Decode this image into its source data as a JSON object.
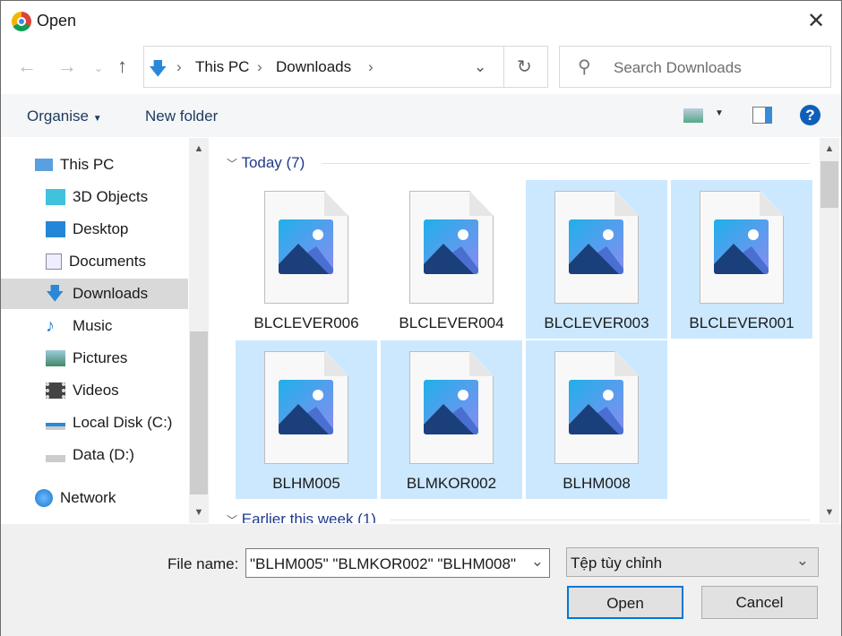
{
  "window": {
    "title": "Open",
    "close": "✕"
  },
  "address": {
    "segments": [
      "This PC",
      "Downloads"
    ],
    "search_placeholder": "Search Downloads"
  },
  "toolbar": {
    "organise": "Organise",
    "new_folder": "New folder",
    "help": "?"
  },
  "nav": {
    "items": [
      {
        "label": "This PC"
      },
      {
        "label": "3D Objects"
      },
      {
        "label": "Desktop"
      },
      {
        "label": "Documents"
      },
      {
        "label": "Downloads",
        "selected": true
      },
      {
        "label": "Music"
      },
      {
        "label": "Pictures"
      },
      {
        "label": "Videos"
      },
      {
        "label": "Local Disk (C:)"
      },
      {
        "label": "Data (D:)"
      },
      {
        "label": "Network"
      }
    ]
  },
  "groups": {
    "today": "Today (7)",
    "earlier": "Earlier this week (1)"
  },
  "files": [
    {
      "name": "BLCLEVER006",
      "selected": false
    },
    {
      "name": "BLCLEVER004",
      "selected": false
    },
    {
      "name": "BLCLEVER003",
      "selected": true
    },
    {
      "name": "BLCLEVER001",
      "selected": true
    },
    {
      "name": "BLHM005",
      "selected": true
    },
    {
      "name": "BLMKOR002",
      "selected": true
    },
    {
      "name": "BLHM008",
      "selected": true
    }
  ],
  "footer": {
    "file_name_label": "File name:",
    "file_name_value": "\"BLHM005\" \"BLMKOR002\" \"BLHM008\"",
    "filter": "Tệp tùy chỉnh",
    "open": "Open",
    "cancel": "Cancel"
  }
}
